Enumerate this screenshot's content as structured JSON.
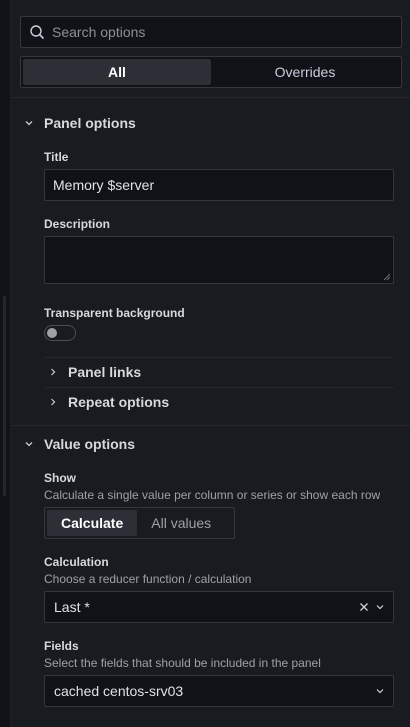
{
  "search": {
    "placeholder": "Search options"
  },
  "mode_tabs": [
    {
      "label": "All"
    },
    {
      "label": "Overrides"
    }
  ],
  "panel_options": {
    "header": "Panel options",
    "title_label": "Title",
    "title_value": "Memory $server",
    "description_label": "Description",
    "transparent_label": "Transparent background",
    "panel_links": "Panel links",
    "repeat_options": "Repeat options"
  },
  "value_options": {
    "header": "Value options",
    "show_label": "Show",
    "show_desc": "Calculate a single value per column or series or show each row",
    "show_options": [
      {
        "label": "Calculate"
      },
      {
        "label": "All values"
      }
    ],
    "calc_label": "Calculation",
    "calc_desc": "Choose a reducer function / calculation",
    "calc_value": "Last *",
    "fields_label": "Fields",
    "fields_desc": "Select the fields that should be included in the panel",
    "fields_value": "cached centos-srv03"
  },
  "colors": {
    "background": "#181b1f",
    "input_bg": "#111217",
    "border": "#34363c",
    "active_tab": "#2c2f35"
  }
}
